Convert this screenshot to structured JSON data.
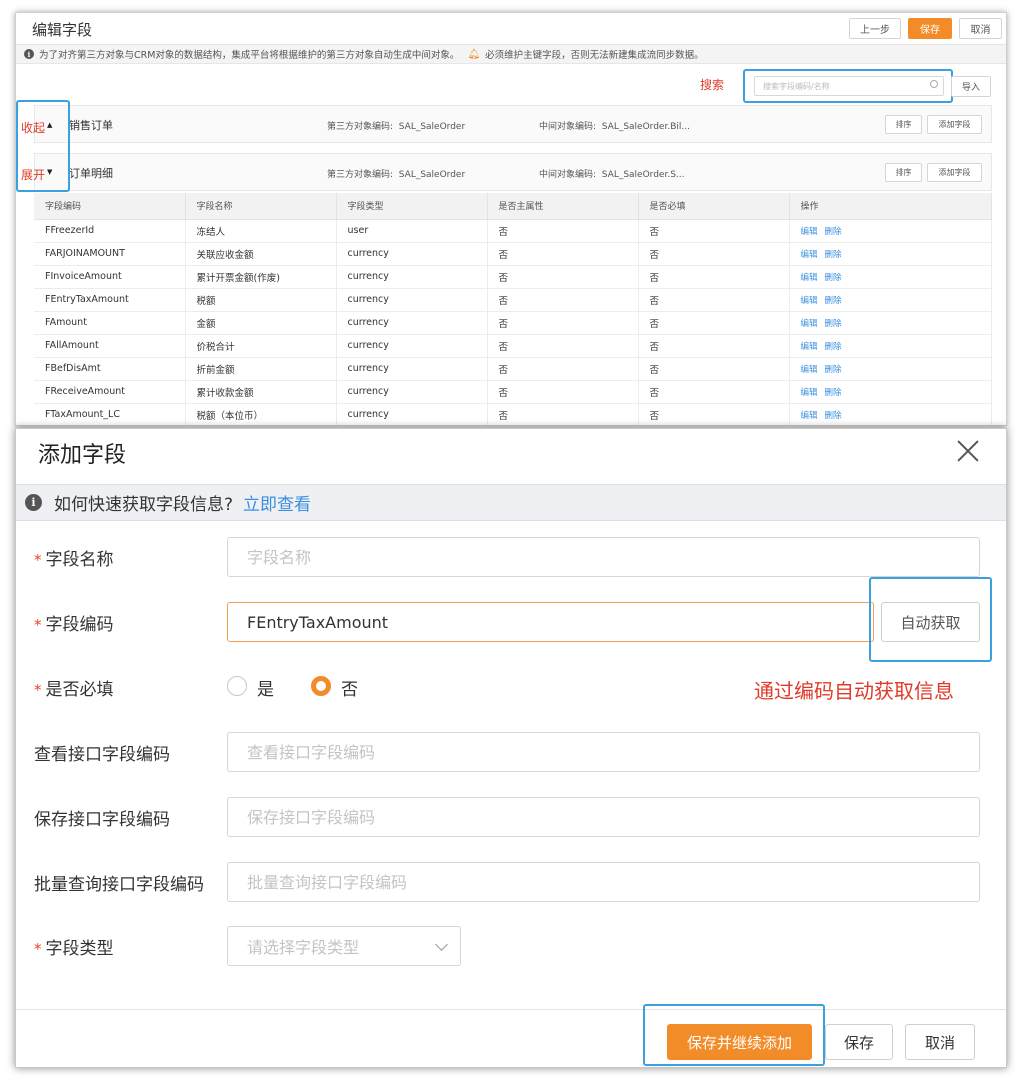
{
  "editor": {
    "title": "编辑字段",
    "buttons": {
      "prev": "上一步",
      "save": "保存",
      "cancel": "取消"
    },
    "notice": "为了对齐第三方对象与CRM对象的数据结构，集成平台将根据维护的第三方对象自动生成中间对象。",
    "warning": "必须维护主键字段，否则无法新建集成流同步数据。",
    "search": {
      "annotation": "搜索",
      "placeholder": "搜索字段编码/名称",
      "import_label": "导入"
    },
    "toggles": {
      "collapse": "收起",
      "expand": "展开"
    },
    "sections": [
      {
        "name": "销售订单",
        "third_party_label": "第三方对象编码:",
        "third_party_value": "SAL_SaleOrder",
        "middle_label": "中间对象编码:",
        "middle_value": "SAL_SaleOrder.Bil...",
        "sort_label": "排序",
        "add_label": "添加字段"
      },
      {
        "name": "订单明细",
        "third_party_label": "第三方对象编码:",
        "third_party_value": "SAL_SaleOrder",
        "middle_label": "中间对象编码:",
        "middle_value": "SAL_SaleOrder.S...",
        "sort_label": "排序",
        "add_label": "添加字段"
      }
    ],
    "table": {
      "headers": [
        "字段编码",
        "字段名称",
        "字段类型",
        "是否主属性",
        "是否必填",
        "操作"
      ],
      "edit_label": "编辑",
      "delete_label": "删除",
      "rows": [
        [
          "FFreezerId",
          "冻结人",
          "user",
          "否",
          "否"
        ],
        [
          "FARJOINAMOUNT",
          "关联应收金额",
          "currency",
          "否",
          "否"
        ],
        [
          "FInvoiceAmount",
          "累计开票金额(作废)",
          "currency",
          "否",
          "否"
        ],
        [
          "FEntryTaxAmount",
          "税额",
          "currency",
          "否",
          "否"
        ],
        [
          "FAmount",
          "金额",
          "currency",
          "否",
          "否"
        ],
        [
          "FAllAmount",
          "价税合计",
          "currency",
          "否",
          "否"
        ],
        [
          "FBefDisAmt",
          "折前金额",
          "currency",
          "否",
          "否"
        ],
        [
          "FReceiveAmount",
          "累计收款金额",
          "currency",
          "否",
          "否"
        ],
        [
          "FTaxAmount_LC",
          "税额（本位币）",
          "currency",
          "否",
          "否"
        ]
      ]
    }
  },
  "modal": {
    "title": "添加字段",
    "tip": {
      "text": "如何快速获取字段信息?",
      "link": "立即查看"
    },
    "fields": {
      "name": {
        "label": "字段名称",
        "placeholder": "字段名称",
        "value": ""
      },
      "code": {
        "label": "字段编码",
        "value": "FEntryTaxAmount",
        "auto_label": "自动获取"
      },
      "required": {
        "label": "是否必填",
        "options": [
          "是",
          "否"
        ],
        "selected": "否"
      },
      "view_code": {
        "label": "查看接口字段编码",
        "placeholder": "查看接口字段编码"
      },
      "save_code": {
        "label": "保存接口字段编码",
        "placeholder": "保存接口字段编码"
      },
      "batch_code": {
        "label": "批量查询接口字段编码",
        "placeholder": "批量查询接口字段编码"
      },
      "type": {
        "label": "字段类型",
        "placeholder": "请选择字段类型"
      }
    },
    "annotation": "通过编码自动获取信息",
    "footer": {
      "save_continue": "保存并继续添加",
      "save": "保存",
      "cancel": "取消"
    }
  }
}
